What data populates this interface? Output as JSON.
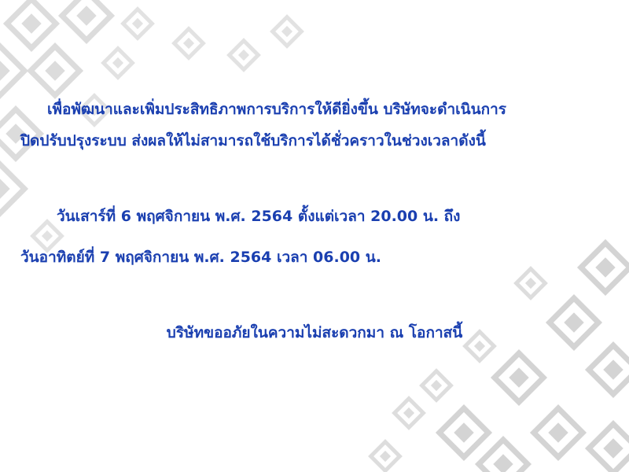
{
  "notice": {
    "paragraph_line_1": "เพื่อพัฒนาและเพิ่มประสิทธิภาพการบริการให้ดียิ่งขึ้น บริษัทจะดำเนินการ",
    "paragraph_line_2": "ปิดปรับปรุงระบบ ส่งผลให้ไม่สามารถใช้บริการได้ชั่วคราวในช่วงเวลาดังนี้",
    "schedule_line_1": "วันเสาร์ที่ 6 พฤศจิกายน พ.ศ. 2564 ตั้งแต่เวลา 20.00 น. ถึง",
    "schedule_line_2": "วันอาทิตย์ที่ 7 พฤศจิกายน พ.ศ. 2564 เวลา 06.00 น.",
    "apology": "บริษัทขออภัยในความไม่สะดวกมา ณ โอกาสนี้"
  },
  "colors": {
    "text": "#1a3fb0",
    "pattern": "#d9d9d9",
    "background": "#ffffff"
  }
}
